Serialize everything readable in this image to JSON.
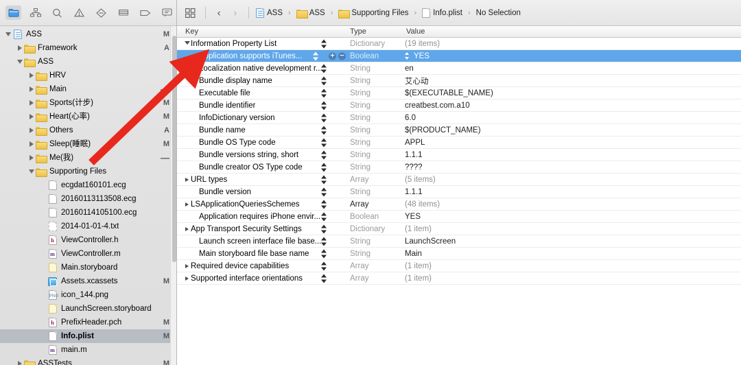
{
  "navigator": {
    "toolbar_icons": [
      {
        "name": "project-navigator-icon",
        "active": true
      },
      {
        "name": "symbol-navigator-icon",
        "active": false
      },
      {
        "name": "find-navigator-icon",
        "active": false
      },
      {
        "name": "issue-navigator-icon",
        "active": false
      },
      {
        "name": "test-navigator-icon",
        "active": false
      },
      {
        "name": "debug-navigator-icon",
        "active": false
      },
      {
        "name": "breakpoint-navigator-icon",
        "active": false
      },
      {
        "name": "report-navigator-icon",
        "active": false
      }
    ],
    "tree": [
      {
        "label": "ASS",
        "icon": "project-icon",
        "depth": 0,
        "twisty": "open",
        "status": "M",
        "selected": false
      },
      {
        "label": "Framework",
        "icon": "folder-icon",
        "depth": 1,
        "twisty": "closed",
        "status": "A",
        "selected": false
      },
      {
        "label": "ASS",
        "icon": "folder-icon",
        "depth": 1,
        "twisty": "open",
        "status": "",
        "selected": false
      },
      {
        "label": "HRV",
        "icon": "folder-icon",
        "depth": 2,
        "twisty": "closed",
        "status": "",
        "selected": false
      },
      {
        "label": "Main",
        "icon": "folder-icon",
        "depth": 2,
        "twisty": "closed",
        "status": "—",
        "selected": false
      },
      {
        "label": "Sports(计步)",
        "icon": "folder-icon",
        "depth": 2,
        "twisty": "closed",
        "status": "M",
        "selected": false
      },
      {
        "label": "Heart(心率)",
        "icon": "folder-icon",
        "depth": 2,
        "twisty": "closed",
        "status": "M",
        "selected": false
      },
      {
        "label": "Others",
        "icon": "folder-icon",
        "depth": 2,
        "twisty": "closed",
        "status": "A",
        "selected": false
      },
      {
        "label": "Sleep(睡眠)",
        "icon": "folder-icon",
        "depth": 2,
        "twisty": "closed",
        "status": "M",
        "selected": false
      },
      {
        "label": "Me(我)",
        "icon": "folder-icon",
        "depth": 2,
        "twisty": "closed",
        "status": "—",
        "selected": false
      },
      {
        "label": "Supporting Files",
        "icon": "folder-icon",
        "depth": 2,
        "twisty": "open",
        "status": "",
        "selected": false
      },
      {
        "label": "ecgdat160101.ecg",
        "icon": "document-icon",
        "depth": 3,
        "twisty": "",
        "status": "",
        "selected": false
      },
      {
        "label": "20160113113508.ecg",
        "icon": "document-icon",
        "depth": 3,
        "twisty": "",
        "status": "",
        "selected": false
      },
      {
        "label": "20160114105100.ecg",
        "icon": "document-icon",
        "depth": 3,
        "twisty": "",
        "status": "",
        "selected": false
      },
      {
        "label": "2014-01-01-4.txt",
        "icon": "text-document-icon",
        "depth": 3,
        "twisty": "",
        "status": "",
        "selected": false
      },
      {
        "label": "ViewController.h",
        "icon": "header-file-icon",
        "depth": 3,
        "twisty": "",
        "status": "",
        "selected": false
      },
      {
        "label": "ViewController.m",
        "icon": "objc-file-icon",
        "depth": 3,
        "twisty": "",
        "status": "",
        "selected": false
      },
      {
        "label": "Main.storyboard",
        "icon": "storyboard-icon",
        "depth": 3,
        "twisty": "",
        "status": "",
        "selected": false
      },
      {
        "label": "Assets.xcassets",
        "icon": "assets-catalog-icon",
        "depth": 3,
        "twisty": "",
        "status": "M",
        "selected": false
      },
      {
        "label": "icon_144.png",
        "icon": "image-file-icon",
        "depth": 3,
        "twisty": "",
        "status": "",
        "selected": false
      },
      {
        "label": "LaunchScreen.storyboard",
        "icon": "storyboard-icon",
        "depth": 3,
        "twisty": "",
        "status": "",
        "selected": false
      },
      {
        "label": "PrefixHeader.pch",
        "icon": "header-file-icon",
        "depth": 3,
        "twisty": "",
        "status": "M",
        "selected": false
      },
      {
        "label": "Info.plist",
        "icon": "plist-icon",
        "depth": 3,
        "twisty": "",
        "status": "M",
        "selected": true
      },
      {
        "label": "main.m",
        "icon": "objc-file-icon",
        "depth": 3,
        "twisty": "",
        "status": "",
        "selected": false
      },
      {
        "label": "ASSTests",
        "icon": "folder-icon",
        "depth": 1,
        "twisty": "closed",
        "status": "M",
        "selected": false
      }
    ]
  },
  "jumpbar": {
    "grid_icon": "editor-layout-icon",
    "back_arrow": "‹",
    "forward_arrow": "›",
    "crumbs": [
      {
        "label": "ASS",
        "icon": "project-icon"
      },
      {
        "label": "ASS",
        "icon": "folder-icon"
      },
      {
        "label": "Supporting Files",
        "icon": "folder-icon"
      },
      {
        "label": "Info.plist",
        "icon": "plist-icon"
      },
      {
        "label": "No Selection",
        "icon": ""
      }
    ]
  },
  "plist": {
    "columns": {
      "key": "Key",
      "type": "Type",
      "value": "Value"
    },
    "rows": [
      {
        "key": "Information Property List",
        "type": "Dictionary",
        "value": "(19 items)",
        "indent": 0,
        "twisty": "open",
        "selected": false,
        "value_dim": true,
        "type_dark": false
      },
      {
        "key": "Application supports iTunes...",
        "type": "Boolean",
        "value": "YES",
        "indent": 1,
        "twisty": "",
        "selected": true,
        "value_dim": false,
        "type_dark": false
      },
      {
        "key": "Localization native development r...",
        "type": "String",
        "value": "en",
        "indent": 1,
        "twisty": "",
        "selected": false,
        "value_dim": false,
        "type_dark": false
      },
      {
        "key": "Bundle display name",
        "type": "String",
        "value": "艾心动",
        "indent": 1,
        "twisty": "",
        "selected": false,
        "value_dim": false,
        "type_dark": false
      },
      {
        "key": "Executable file",
        "type": "String",
        "value": "$(EXECUTABLE_NAME)",
        "indent": 1,
        "twisty": "",
        "selected": false,
        "value_dim": false,
        "type_dark": false
      },
      {
        "key": "Bundle identifier",
        "type": "String",
        "value": "creatbest.com.a10",
        "indent": 1,
        "twisty": "",
        "selected": false,
        "value_dim": false,
        "type_dark": false
      },
      {
        "key": "InfoDictionary version",
        "type": "String",
        "value": "6.0",
        "indent": 1,
        "twisty": "",
        "selected": false,
        "value_dim": false,
        "type_dark": false
      },
      {
        "key": "Bundle name",
        "type": "String",
        "value": "$(PRODUCT_NAME)",
        "indent": 1,
        "twisty": "",
        "selected": false,
        "value_dim": false,
        "type_dark": false
      },
      {
        "key": "Bundle OS Type code",
        "type": "String",
        "value": "APPL",
        "indent": 1,
        "twisty": "",
        "selected": false,
        "value_dim": false,
        "type_dark": false
      },
      {
        "key": "Bundle versions string, short",
        "type": "String",
        "value": "1.1.1",
        "indent": 1,
        "twisty": "",
        "selected": false,
        "value_dim": false,
        "type_dark": false
      },
      {
        "key": "Bundle creator OS Type code",
        "type": "String",
        "value": "????",
        "indent": 1,
        "twisty": "",
        "selected": false,
        "value_dim": false,
        "type_dark": false
      },
      {
        "key": "URL types",
        "type": "Array",
        "value": "(5 items)",
        "indent": 0,
        "twisty": "closed",
        "selected": false,
        "value_dim": true,
        "type_dark": false
      },
      {
        "key": "Bundle version",
        "type": "String",
        "value": "1.1.1",
        "indent": 1,
        "twisty": "",
        "selected": false,
        "value_dim": false,
        "type_dark": false
      },
      {
        "key": "LSApplicationQueriesSchemes",
        "type": "Array",
        "value": "(48 items)",
        "indent": 0,
        "twisty": "closed",
        "selected": false,
        "value_dim": true,
        "type_dark": true
      },
      {
        "key": "Application requires iPhone envir...",
        "type": "Boolean",
        "value": "YES",
        "indent": 1,
        "twisty": "",
        "selected": false,
        "value_dim": false,
        "type_dark": false
      },
      {
        "key": "App Transport Security Settings",
        "type": "Dictionary",
        "value": "(1 item)",
        "indent": 0,
        "twisty": "closed",
        "selected": false,
        "value_dim": true,
        "type_dark": false
      },
      {
        "key": "Launch screen interface file base...",
        "type": "String",
        "value": "LaunchScreen",
        "indent": 1,
        "twisty": "",
        "selected": false,
        "value_dim": false,
        "type_dark": false
      },
      {
        "key": "Main storyboard file base name",
        "type": "String",
        "value": "Main",
        "indent": 1,
        "twisty": "",
        "selected": false,
        "value_dim": false,
        "type_dark": false
      },
      {
        "key": "Required device capabilities",
        "type": "Array",
        "value": "(1 item)",
        "indent": 0,
        "twisty": "closed",
        "selected": false,
        "value_dim": true,
        "type_dark": false
      },
      {
        "key": "Supported interface orientations",
        "type": "Array",
        "value": "(1 item)",
        "indent": 0,
        "twisty": "closed",
        "selected": false,
        "value_dim": true,
        "type_dark": false
      }
    ],
    "selected_row_controls": {
      "add": "+",
      "remove": "−"
    }
  },
  "annotation": {
    "arrow_color": "#e8281c",
    "name": "red-arrow-annotation"
  }
}
